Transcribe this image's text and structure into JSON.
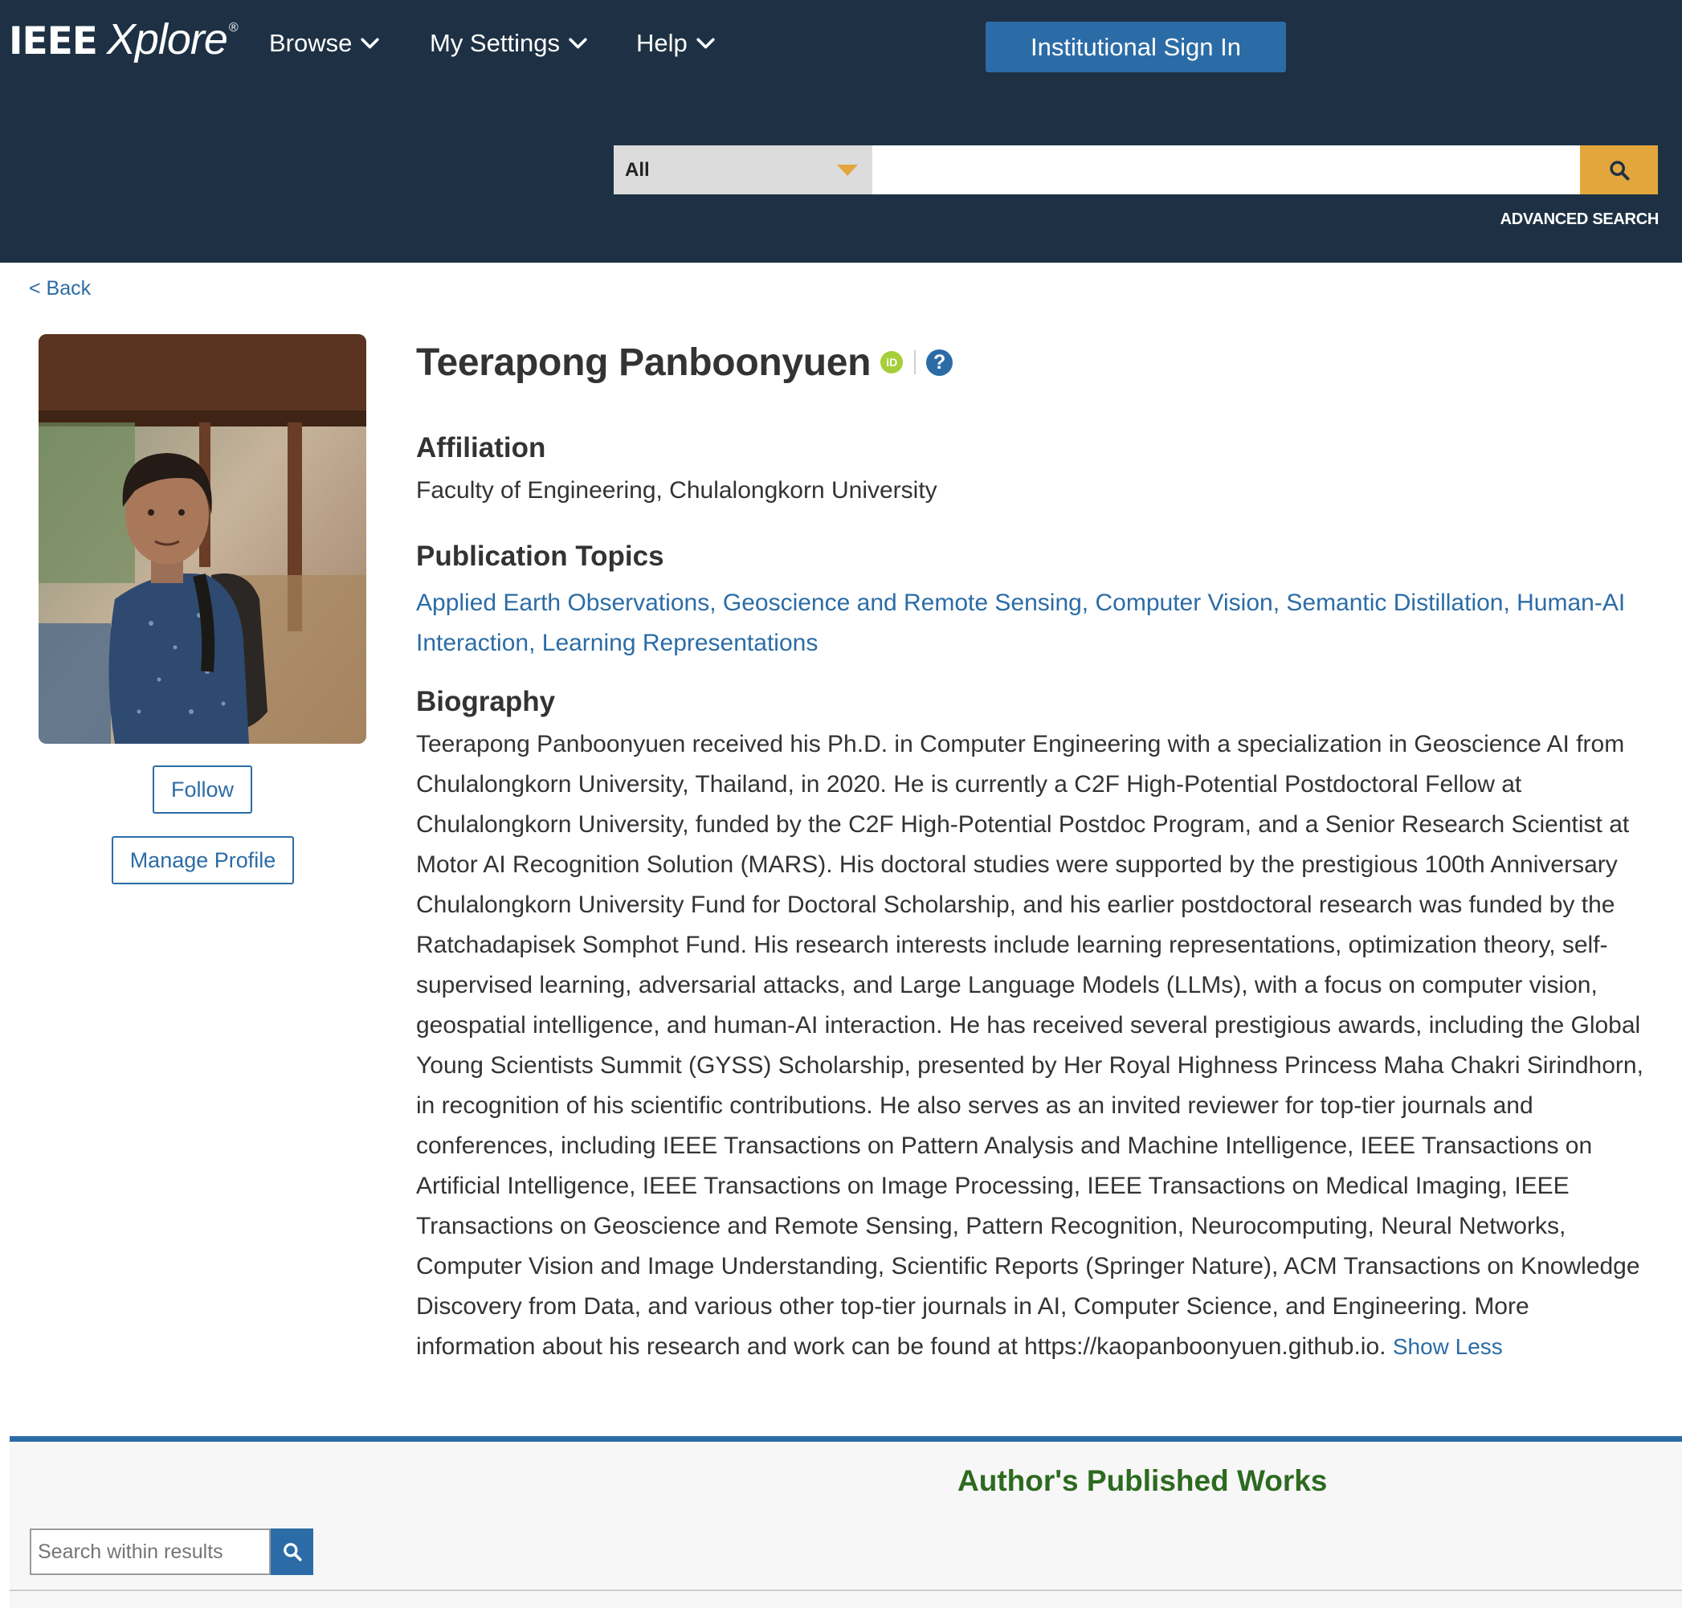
{
  "header": {
    "logo": {
      "brand": "IEEE",
      "product": "Xplore",
      "mark": "®"
    },
    "nav": [
      {
        "label": "Browse"
      },
      {
        "label": "My Settings"
      },
      {
        "label": "Help"
      }
    ],
    "signin_label": "Institutional Sign In",
    "search": {
      "scope": "All",
      "value": "",
      "placeholder": "",
      "advanced_label": "ADVANCED SEARCH"
    }
  },
  "back_label": "< Back",
  "profile": {
    "follow_label": "Follow",
    "manage_label": "Manage Profile",
    "name": "Teerapong Panboonyuen",
    "orcid_icon": "iD",
    "help_icon": "?",
    "affiliation_heading": "Affiliation",
    "affiliation": "Faculty of Engineering, Chulalongkorn University",
    "topics_heading": "Publication Topics",
    "topics": "Applied Earth Observations, Geoscience and Remote Sensing, Computer Vision, Semantic Distillation, Human-AI Interaction, Learning Representations",
    "biography_heading": "Biography",
    "biography": "Teerapong Panboonyuen received his Ph.D. in Computer Engineering with a specialization in Geoscience AI from Chulalongkorn University, Thailand, in 2020. He is currently a C2F High-Potential Postdoctoral Fellow at Chulalongkorn University, funded by the C2F High-Potential Postdoc Program, and a Senior Research Scientist at Motor AI Recognition Solution (MARS). His doctoral studies were supported by the prestigious 100th Anniversary Chulalongkorn University Fund for Doctoral Scholarship, and his earlier postdoctoral research was funded by the Ratchadapisek Somphot Fund. His research interests include learning representations, optimization theory, self-supervised learning, adversarial attacks, and Large Language Models (LLMs), with a focus on computer vision, geospatial intelligence, and human-AI interaction. He has received several prestigious awards, including the Global Young Scientists Summit (GYSS) Scholarship, presented by Her Royal Highness Princess Maha Chakri Sirindhorn, in recognition of his scientific contributions. He also serves as an invited reviewer for top-tier journals and conferences, including IEEE Transactions on Pattern Analysis and Machine Intelligence, IEEE Transactions on Artificial Intelligence, IEEE Transactions on Image Processing, IEEE Transactions on Medical Imaging, IEEE Transactions on Geoscience and Remote Sensing, Pattern Recognition, Neurocomputing, Neural Networks, Computer Vision and Image Understanding, Scientific Reports (Springer Nature), ACM Transactions on Knowledge Discovery from Data, and various other top-tier journals in AI, Computer Science, and Engineering. More information about his research and work can be found at https://kaopanboonyuen.github.io.",
    "show_less_label": "Show Less"
  },
  "works": {
    "title": "Author's Published Works",
    "search_placeholder": "Search within results"
  },
  "icons": {
    "chevron": "chevron-down-icon",
    "search": "search-icon",
    "orcid": "orcid-icon",
    "help": "help-icon"
  },
  "colors": {
    "header_bg": "#1e3144",
    "accent_blue": "#2c6ca6",
    "search_gold": "#e3a63d",
    "works_title_green": "#2d6a20",
    "orcid_green": "#a6ce39"
  }
}
